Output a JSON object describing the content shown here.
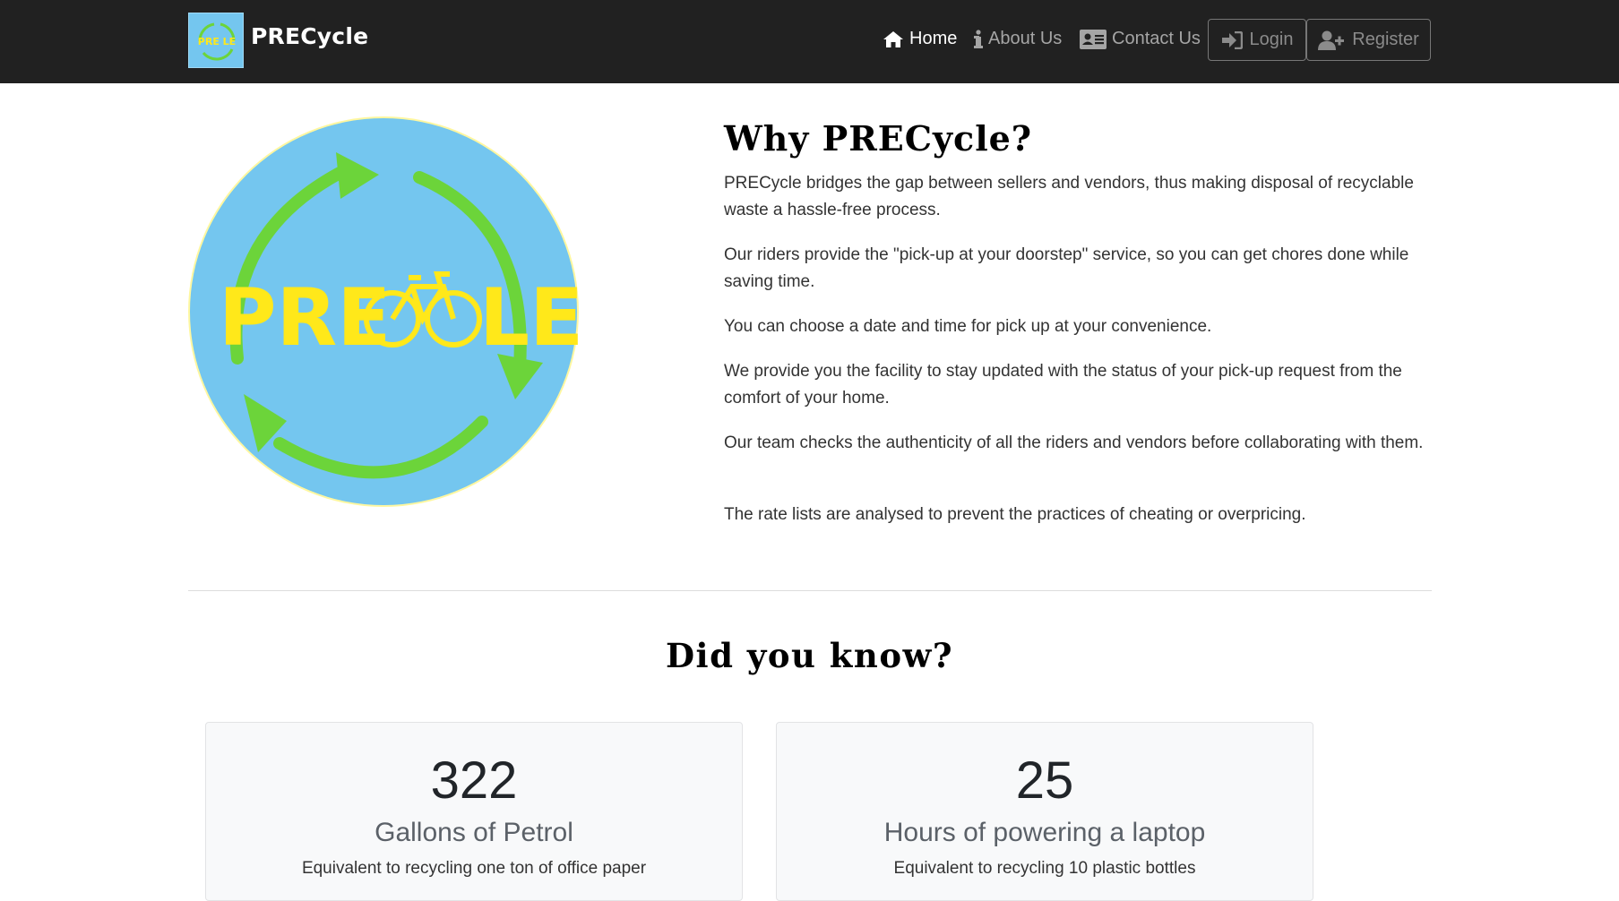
{
  "brand": {
    "name": "PRECycle",
    "logo_text": "PRE LE"
  },
  "nav": {
    "home": "Home",
    "about": "About Us",
    "contact": "Contact Us",
    "login": "Login",
    "register": "Register"
  },
  "why": {
    "title": "Why PRECycle?",
    "paragraphs": [
      "PRECycle bridges the gap between sellers and vendors, thus making disposal of recyclable waste a hassle-free process.",
      "Our riders provide the \"pick-up at your doorstep\" service, so you can get chores done while saving time.",
      "You can choose a date and time for pick up at your convenience.",
      "We provide you the facility to stay updated with the status of your pick-up request from the comfort of your home.",
      "Our team checks the authenticity of all the riders and vendors before collaborating with them.",
      "The rate lists are analysed to prevent the practices of cheating or overpricing."
    ]
  },
  "did_you_know": {
    "title": "Did you know?",
    "cards": [
      {
        "number": "322",
        "label": "Gallons of Petrol",
        "desc": "Equivalent to recycling one ton of office paper"
      },
      {
        "number": "25",
        "label": "Hours of powering a laptop",
        "desc": "Equivalent to recycling 10 plastic bottles"
      }
    ]
  },
  "colors": {
    "navbar_bg": "#212121",
    "logo_circle": "#74c6ef",
    "logo_arrows": "#6cd43a",
    "logo_text": "#ffe81a"
  },
  "icons": [
    "home-icon",
    "info-icon",
    "contact-card-icon",
    "login-icon",
    "user-plus-icon",
    "bicycle-icon",
    "recycle-arrows-icon"
  ]
}
